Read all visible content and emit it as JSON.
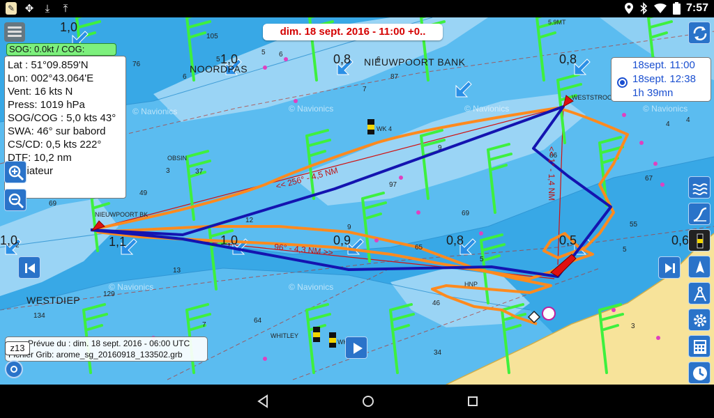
{
  "status_bar": {
    "time": "7:57",
    "left_icons": [
      "app-icon",
      "sync-icon",
      "download-icon",
      "upload-icon"
    ],
    "right_icons": [
      "location-icon",
      "bluetooth-icon",
      "wifi-icon",
      "battery-icon"
    ]
  },
  "map": {
    "date_banner": "dim. 18 sept. 2016 - 11:00 +0..",
    "sog_cog": "SOG: 0.0kt / COG: ",
    "info": {
      "lat": "Lat :  51°09.859'N",
      "lon": "Lon: 002°43.064'E",
      "wind": "Vent:  16 kts  N",
      "press": "Press: 1019 hPa",
      "sogcog": "SOG/COG : 5,0 kts 43°",
      "swa": "SWA: 46° sur babord",
      "cscd": "CS/CD: 0,5 kts 222°",
      "dtf": "DTF: 10,2 nm",
      "radiateur": "Radiateur"
    },
    "time_panel": {
      "start": "18sept. 11:00",
      "end": "18sept. 12:38",
      "duration": "1h 39mn"
    },
    "zoom_level": "z13",
    "grib": {
      "line1": "Prévue du : dim. 18 sept. 2016 - 06:00 UTC",
      "line2": "Fichier Grib: arome_sg_20160918_133502.grb"
    },
    "places": {
      "noordpas": "NOORDPAS",
      "nieuwpoortbank": "NIEUWPOORT BANK",
      "westdiep": "WESTDIEP",
      "weststroombank": "WESTSTROOMB",
      "obsin": "OBSIN",
      "nieuwpoortbk": "NIEUWPOORT BK",
      "whitley": "WHITLEY",
      "wk4": "WK 4",
      "hnp": "HNP",
      "wk": "WK",
      "fivemt": "5.9MT",
      "navionics": "© Navionics"
    },
    "route_labels": {
      "leg1": "<< 256° - 4,5 NM",
      "leg2": "96° - 4,3 NM >>",
      "leg3": "<< 1° - 1,4 NM"
    },
    "current_values": [
      "1,0",
      "1,0",
      "0,8",
      "0,8",
      "1,1",
      "1,0",
      "0,9",
      "0,8",
      "0,5",
      "0,6",
      "1,0"
    ],
    "colors": {
      "shallow": "#9ad4f5",
      "mid": "#5bbcf0",
      "deep": "#38a8e6",
      "land": "#f7e39a",
      "wind_barb": "#3ef03e",
      "track": "#ff8a1e",
      "route": "#1414b0",
      "rhumb": "#d01010",
      "date_text": "#d40000",
      "panel_text": "#1a4fd0"
    }
  },
  "buttons": {
    "menu": "menu-icon",
    "zoom_in": "zoom-in-icon",
    "zoom_out": "zoom-out-icon",
    "prev": "skip-previous-icon",
    "next": "skip-next-icon",
    "play": "play-icon",
    "right_toolbar": [
      "weather-layers-icon",
      "route-profile-icon",
      "buoy-icon",
      "boat-icon",
      "compass-icon",
      "settings-icon",
      "calculator-icon",
      "clock-icon"
    ]
  }
}
